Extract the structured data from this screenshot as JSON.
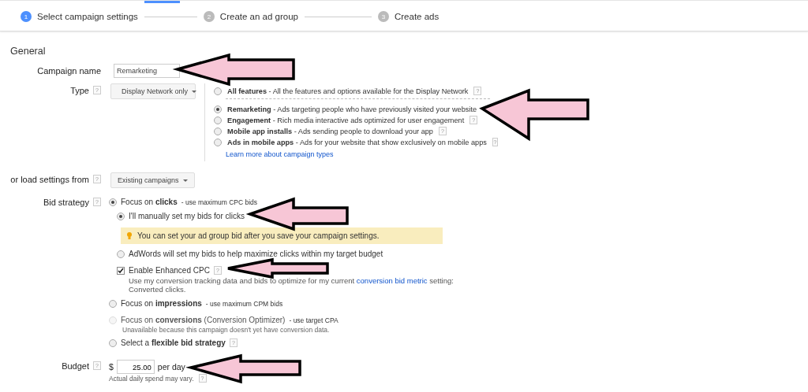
{
  "steps": [
    {
      "number": "1",
      "label": "Select campaign settings",
      "selected": true
    },
    {
      "number": "2",
      "label": "Create an ad group",
      "selected": false
    },
    {
      "number": "3",
      "label": "Create ads",
      "selected": false
    }
  ],
  "section_title": "General",
  "campaign_name": {
    "label": "Campaign name",
    "value": "Remarketing"
  },
  "type": {
    "label": "Type",
    "help": "?",
    "dropdown": "Display Network only",
    "options": [
      {
        "title": "All features",
        "description": " - All the features and options available for the Display Network",
        "help": "?",
        "selected": false
      },
      {
        "title": "Remarketing",
        "description": " - Ads targeting people who have previously visited your website",
        "selected": true
      },
      {
        "title": "Engagement",
        "description": " - Rich media interactive ads optimized for user engagement",
        "help": "?",
        "selected": false
      },
      {
        "title": "Mobile app installs",
        "description": " - Ads sending people to download your app",
        "help": "?",
        "selected": false
      },
      {
        "title": "Ads in mobile apps",
        "description": " - Ads for your website that show exclusively on mobile apps",
        "help": "?",
        "selected": false
      }
    ],
    "link": "Learn more about campaign types"
  },
  "load_settings": {
    "label": "or load settings from",
    "help": "?",
    "dropdown": "Existing campaigns"
  },
  "bid_strategy": {
    "label": "Bid strategy",
    "help": "?",
    "options": [
      {
        "kind": "radio",
        "text": "Focus on **clicks**",
        "note": "- use maximum CPC bids",
        "selected": true,
        "disabled": false,
        "children": [
          {
            "kind": "radio",
            "text": "I'll manually set my bids for clicks",
            "selected": true,
            "disabled": false
          },
          {
            "kind": "tip",
            "text": "You can set your ad group bid after you save your campaign settings."
          },
          {
            "kind": "radio",
            "text": "AdWords will set my bids to help maximize clicks within my target budget",
            "selected": false,
            "disabled": false
          },
          {
            "kind": "checkbox",
            "text": "Enable Enhanced CPC",
            "help": "?",
            "checked": true,
            "description": "Use my conversion tracking data and bids to optimize for my current",
            "link": "conversion bid metric",
            "after": "setting: Converted clicks."
          }
        ]
      },
      {
        "kind": "radio",
        "text": "Focus on **impressions**",
        "note": "- use maximum CPM bids",
        "selected": false,
        "disabled": false
      },
      {
        "kind": "radio",
        "text": "Focus on **conversions** (Conversion Optimizer)",
        "note": "- use target CPA",
        "selected": false,
        "disabled": true,
        "sub": "Unavailable because this campaign doesn't yet have conversion data."
      },
      {
        "kind": "radio",
        "text": "Select a **flexible bid strategy**",
        "help": "?",
        "selected": false,
        "disabled": false
      }
    ]
  },
  "budget": {
    "label": "Budget",
    "help": "?",
    "currency": "$",
    "value": "25.00",
    "unit": "per day",
    "note": "Actual daily spend may vary.",
    "note_help": "?"
  }
}
